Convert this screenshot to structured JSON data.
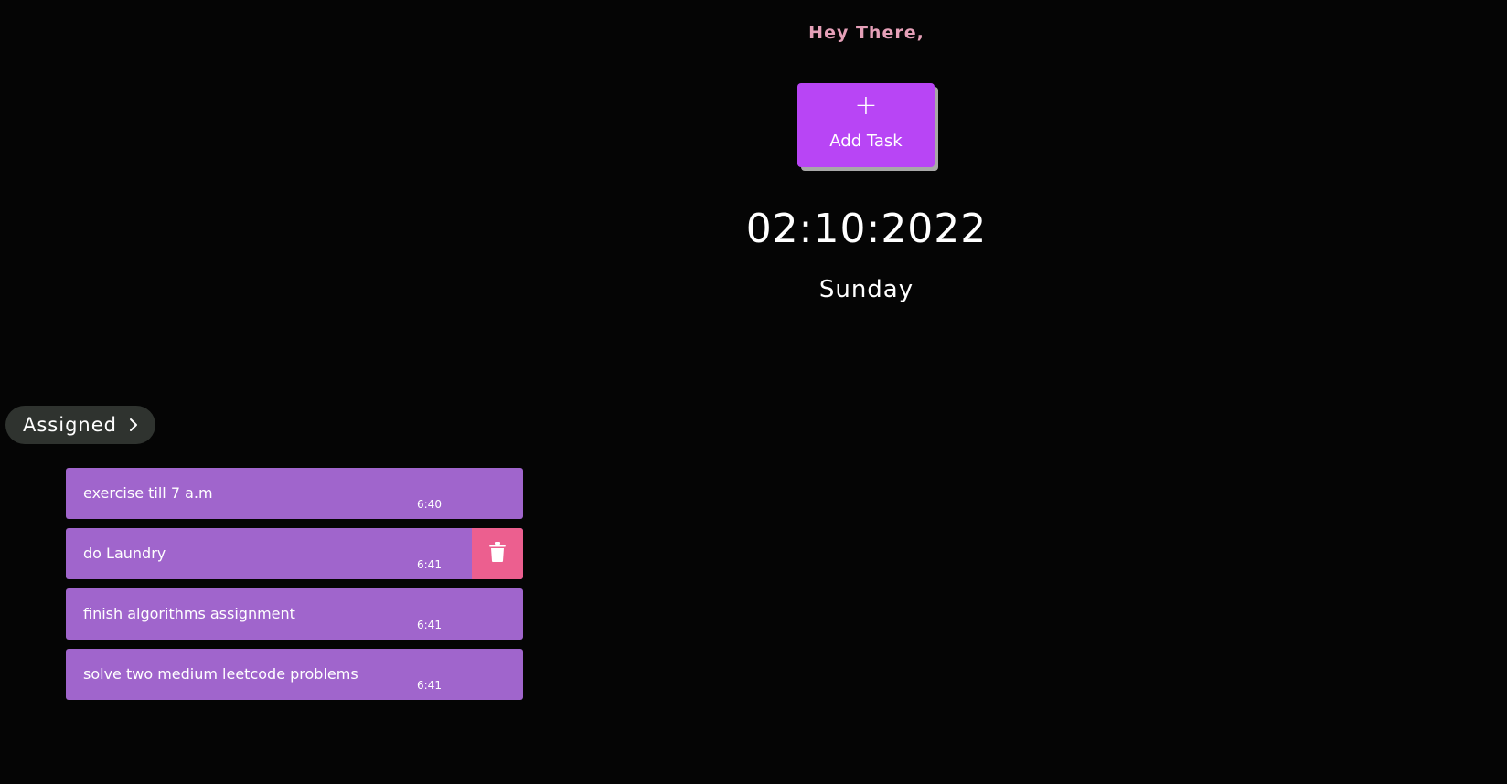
{
  "header": {
    "greeting": "Hey There,"
  },
  "add_task": {
    "icon": "plus-icon",
    "label": "Add Task"
  },
  "date_display": {
    "date": "02:10:2022",
    "weekday": "Sunday"
  },
  "section": {
    "label": "Assigned",
    "icon": "chevron-right-icon"
  },
  "tasks": [
    {
      "title": "exercise till 7 a.m",
      "time": "6:40"
    },
    {
      "title": "do Laundry",
      "time": "6:41",
      "delete_icon": "trash-icon"
    },
    {
      "title": "finish algorithms assignment",
      "time": "6:41"
    },
    {
      "title": "solve two medium leetcode problems",
      "time": "6:41"
    }
  ],
  "colors": {
    "background": "#050505",
    "greeting": "#e5a0b8",
    "add_button": "#b845f5",
    "task_card": "#a065cc",
    "delete_button": "#ec5f8f",
    "pill": "#2f332f"
  }
}
